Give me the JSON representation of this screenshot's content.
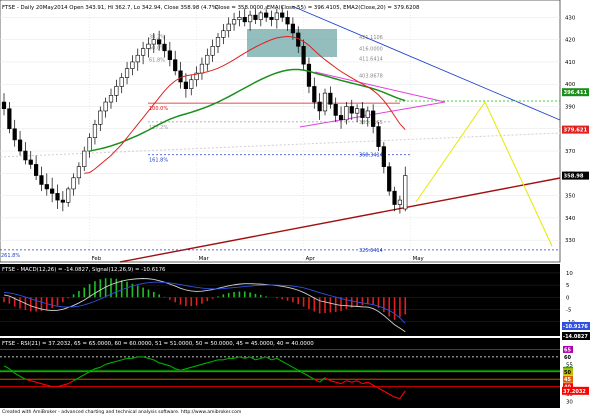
{
  "header": {
    "symbol": "FTSE",
    "info": "FTSE - Daily 20May2014 Open 343.91, Hi 362.7, Lo 342.94, Close 358.98 (4.7%)",
    "ema_label": "Close = 358.0000, EMA(Close,55) = 396.4105, EMA2(Close,20) = 379.6208"
  },
  "footer": "Created with AmiBroker - advanced charting and technical analysis software. http://www.amibroker.com",
  "macd_label": "FTSE - MACD(12,26) = -14.0827, Signal(12,26,9) = -10.6176",
  "rsi_label": "FTSE - RSI(21) = 37.2032, 65 = 65.0000, 60 = 60.0000, 51 = 51.0000, 50 = 50.0000, 45 = 45.0000, 40 = 40.0000",
  "chart_data": [
    {
      "type": "candlestick",
      "panel": "price",
      "ylim": [
        322,
        436
      ],
      "y_ticks": [
        330,
        340,
        350,
        360,
        370,
        380,
        390,
        400,
        410,
        420,
        430
      ],
      "x_labels": [
        "Feb",
        "Mar",
        "Apr",
        "May"
      ],
      "x_label_index": [
        16,
        36,
        56,
        76
      ],
      "candles": [
        [
          392,
          396,
          386,
          389
        ],
        [
          389,
          392,
          378,
          380
        ],
        [
          380,
          384,
          372,
          375
        ],
        [
          375,
          379,
          368,
          370
        ],
        [
          370,
          374,
          364,
          366
        ],
        [
          366,
          370,
          362,
          364
        ],
        [
          364,
          368,
          357,
          359
        ],
        [
          359,
          363,
          352,
          355
        ],
        [
          355,
          360,
          350,
          353
        ],
        [
          353,
          358,
          347,
          351
        ],
        [
          351,
          355,
          344,
          348
        ],
        [
          348,
          352,
          343,
          347
        ],
        [
          347,
          354,
          345,
          353
        ],
        [
          353,
          360,
          350,
          358
        ],
        [
          358,
          365,
          355,
          363
        ],
        [
          363,
          372,
          361,
          370
        ],
        [
          370,
          378,
          367,
          376
        ],
        [
          376,
          384,
          373,
          382
        ],
        [
          382,
          390,
          379,
          388
        ],
        [
          388,
          394,
          385,
          392
        ],
        [
          392,
          398,
          389,
          395
        ],
        [
          395,
          402,
          392,
          399
        ],
        [
          399,
          405,
          396,
          403
        ],
        [
          403,
          410,
          400,
          407
        ],
        [
          407,
          413,
          404,
          410
        ],
        [
          410,
          416,
          406,
          413
        ],
        [
          413,
          419,
          409,
          416
        ],
        [
          416,
          421,
          412,
          418
        ],
        [
          418,
          423,
          414,
          420
        ],
        [
          420,
          424,
          415,
          418
        ],
        [
          418,
          422,
          412,
          415
        ],
        [
          415,
          419,
          408,
          411
        ],
        [
          411,
          415,
          404,
          406
        ],
        [
          406,
          410,
          398,
          401
        ],
        [
          401,
          405,
          394,
          398
        ],
        [
          398,
          404,
          395,
          402
        ],
        [
          402,
          408,
          399,
          405
        ],
        [
          405,
          412,
          402,
          409
        ],
        [
          409,
          416,
          406,
          413
        ],
        [
          413,
          420,
          410,
          417
        ],
        [
          417,
          423,
          414,
          421
        ],
        [
          421,
          427,
          418,
          424
        ],
        [
          424,
          430,
          421,
          427
        ],
        [
          427,
          432,
          424,
          429
        ],
        [
          429,
          433,
          426,
          430
        ],
        [
          430,
          434,
          426,
          428
        ],
        [
          428,
          433,
          424,
          431
        ],
        [
          431,
          434,
          427,
          429
        ],
        [
          429,
          433,
          426,
          432
        ],
        [
          432,
          435,
          428,
          430
        ],
        [
          430,
          433,
          426,
          429
        ],
        [
          429,
          434,
          425,
          432
        ],
        [
          432,
          435,
          428,
          430
        ],
        [
          430,
          433,
          424,
          427
        ],
        [
          427,
          430,
          420,
          423
        ],
        [
          423,
          426,
          414,
          417
        ],
        [
          417,
          420,
          406,
          409
        ],
        [
          409,
          412,
          396,
          399
        ],
        [
          399,
          403,
          389,
          392
        ],
        [
          392,
          396,
          384,
          388
        ],
        [
          388,
          398,
          386,
          396
        ],
        [
          396,
          399,
          389,
          391
        ],
        [
          391,
          394,
          383,
          386
        ],
        [
          386,
          390,
          380,
          384
        ],
        [
          384,
          392,
          382,
          390
        ],
        [
          390,
          393,
          384,
          387
        ],
        [
          387,
          391,
          383,
          389
        ],
        [
          389,
          392,
          382,
          385
        ],
        [
          385,
          390,
          381,
          388
        ],
        [
          388,
          391,
          378,
          381
        ],
        [
          381,
          383,
          370,
          372
        ],
        [
          372,
          374,
          360,
          363
        ],
        [
          363,
          365,
          350,
          352
        ],
        [
          352,
          354,
          343,
          346
        ],
        [
          346,
          350,
          342,
          348
        ],
        [
          344,
          363,
          343,
          359
        ]
      ],
      "series": [
        {
          "name": "EMA(Close,55)",
          "color": "#1a8f1a",
          "values": [
            null,
            null,
            null,
            null,
            null,
            null,
            null,
            null,
            null,
            null,
            null,
            null,
            null,
            null,
            null,
            null,
            370,
            370.5,
            371,
            371.6,
            372.3,
            373.1,
            374,
            375,
            376,
            377,
            378.2,
            379.4,
            380.7,
            382,
            383.2,
            384.3,
            385.2,
            386,
            386.7,
            387.4,
            388.2,
            389,
            389.9,
            390.9,
            392,
            393.2,
            394.4,
            395.7,
            397,
            398.3,
            399.6,
            400.9,
            402.1,
            403.2,
            404.2,
            405.1,
            405.8,
            406.3,
            406.6,
            406.6,
            406.3,
            405.8,
            405.1,
            404.4,
            403.8,
            403.1,
            402.4,
            401.7,
            401.1,
            400.5,
            399.9,
            399.3,
            398.7,
            398,
            397.2,
            396.3,
            395.3,
            394.3,
            393.4,
            392.6
          ]
        },
        {
          "name": "EMA2(Close,20)",
          "color": "#e02020",
          "values": [
            null,
            null,
            null,
            null,
            null,
            null,
            null,
            null,
            null,
            null,
            null,
            null,
            null,
            null,
            null,
            360,
            360.3,
            362,
            364,
            366,
            368,
            370.5,
            373,
            376,
            379,
            382,
            385,
            388,
            391,
            394,
            397,
            399.5,
            401.5,
            403,
            403.8,
            404.2,
            404.5,
            405,
            405.6,
            406.3,
            407.2,
            408.3,
            409.6,
            411,
            412.5,
            414,
            415.4,
            416.7,
            417.9,
            419,
            420,
            420.8,
            421.2,
            421.4,
            421.2,
            420.5,
            419.2,
            417.4,
            415.2,
            413,
            411,
            409.2,
            407.4,
            405.7,
            404.2,
            402.8,
            401.4,
            400.1,
            398.8,
            397.2,
            395.2,
            392.6,
            389.4,
            385.8,
            382.2,
            379.6
          ]
        }
      ],
      "levels": [
        {
          "label": "100.0%",
          "value": 391.5
        },
        {
          "label": "127.2%",
          "value": 383.1
        },
        {
          "label": "161.8%",
          "value": 368.3414
        },
        {
          "label": "261.8%",
          "value": 325.6414
        }
      ],
      "level_values": [
        "421.1106",
        "416.0000",
        "411.6414",
        "403.8678",
        "383.1165",
        "368.3414",
        "325.6414"
      ],
      "upper_left_labels": [
        "38.2%",
        "50.0%",
        "61.8%"
      ],
      "right_tags": [
        {
          "value": 396.411,
          "label": "396.411",
          "color": "#1a8f1a"
        },
        {
          "value": 379.621,
          "label": "379.621",
          "color": "#e02020"
        },
        {
          "value": 358.98,
          "label": "358.98",
          "color": "#000000"
        }
      ]
    },
    {
      "type": "line",
      "panel": "macd",
      "title": "MACD(12,26) / Signal(12,26,9)",
      "ylim": [
        -15,
        12
      ],
      "y_ticks": [
        10,
        5,
        0,
        -5,
        -10
      ],
      "series": [
        {
          "name": "MACD(12,26)",
          "color": "#000000",
          "values": [
            1,
            0.5,
            -0.5,
            -1.5,
            -2.5,
            -3.5,
            -4.2,
            -4.8,
            -5.2,
            -5.4,
            -5.3,
            -4.9,
            -4.2,
            -3.3,
            -2.3,
            -1.1,
            0.3,
            1.7,
            3,
            4.2,
            5.2,
            6,
            6.6,
            7.1,
            7.4,
            7.6,
            7.7,
            7.6,
            7.3,
            6.8,
            6.2,
            5.4,
            4.6,
            3.7,
            3,
            2.6,
            2.4,
            2.5,
            2.8,
            3.2,
            3.7,
            4.2,
            4.7,
            5.1,
            5.4,
            5.6,
            5.6,
            5.5,
            5.4,
            5.2,
            5,
            4.8,
            4.5,
            4.1,
            3.6,
            2.9,
            2,
            0.9,
            -0.3,
            -1.4,
            -1.9,
            -2.4,
            -2.9,
            -3.3,
            -3.4,
            -3.6,
            -3.7,
            -3.9,
            -4,
            -4.6,
            -5.8,
            -7.4,
            -9.3,
            -11.2,
            -12.6,
            -14.1
          ]
        },
        {
          "name": "Signal(12,26,9)",
          "color": "#3050e0",
          "values": [
            2,
            1.8,
            1.4,
            0.8,
            0.1,
            -0.6,
            -1.3,
            -2,
            -2.6,
            -3.2,
            -3.6,
            -3.9,
            -4,
            -3.9,
            -3.6,
            -3.1,
            -2.4,
            -1.6,
            -0.7,
            0.3,
            1.3,
            2.2,
            3.1,
            3.9,
            4.6,
            5.2,
            5.7,
            6,
            6.2,
            6.2,
            6.1,
            5.9,
            5.6,
            5.2,
            4.8,
            4.4,
            4.1,
            3.8,
            3.6,
            3.5,
            3.5,
            3.6,
            3.8,
            4,
            4.2,
            4.4,
            4.6,
            4.8,
            4.9,
            5,
            5,
            5,
            4.9,
            4.8,
            4.6,
            4.3,
            3.9,
            3.3,
            2.6,
            1.9,
            1.3,
            0.7,
            0.1,
            -0.5,
            -1,
            -1.5,
            -1.9,
            -2.3,
            -2.6,
            -3,
            -3.6,
            -4.4,
            -5.4,
            -6.6,
            -8.5,
            -10.6
          ]
        }
      ],
      "right_tags": [
        {
          "value": -10.6176,
          "label": "-10.9176",
          "color": "#3050e0"
        },
        {
          "value": -14.0827,
          "label": "-14.0827",
          "color": "#000000"
        }
      ]
    },
    {
      "type": "line",
      "panel": "rsi",
      "title": "RSI(21)",
      "ylim": [
        27,
        70
      ],
      "y_ticks": [
        30,
        35,
        40,
        45,
        50,
        55,
        60,
        65
      ],
      "levels": [
        {
          "label": "65",
          "value": 65,
          "color": "#b000b0"
        },
        {
          "label": "60",
          "value": 60,
          "color": "#ffffff"
        },
        {
          "label": "51",
          "value": 51,
          "color": "#00c000"
        },
        {
          "label": "50",
          "value": 50,
          "color": "#c0c000"
        },
        {
          "label": "45",
          "value": 45,
          "color": "#e06000"
        },
        {
          "label": "40",
          "value": 40,
          "color": "#ff0000"
        }
      ],
      "series": [
        {
          "name": "RSI(21)",
          "color": "#00b000",
          "values": [
            54,
            52,
            49,
            47,
            45,
            44,
            43,
            42,
            41,
            40,
            40,
            41,
            42,
            44,
            46,
            48,
            50,
            52,
            53,
            55,
            56,
            57,
            58,
            59,
            59,
            60,
            60,
            59,
            58,
            56,
            55,
            54,
            52,
            51,
            52,
            53,
            54,
            55,
            56,
            57,
            58,
            58,
            59,
            59,
            60,
            59,
            60,
            58,
            59,
            60,
            58,
            59,
            57,
            55,
            53,
            51,
            49,
            47,
            45,
            43,
            46,
            44,
            43,
            42,
            44,
            43,
            44,
            42,
            43,
            41,
            39,
            37,
            35,
            33,
            32,
            37.2
          ]
        }
      ],
      "below_color": "#ff0000",
      "right_tags": [
        {
          "value": 37.2,
          "label": "37.2032",
          "color": "#ff0000"
        }
      ]
    }
  ]
}
